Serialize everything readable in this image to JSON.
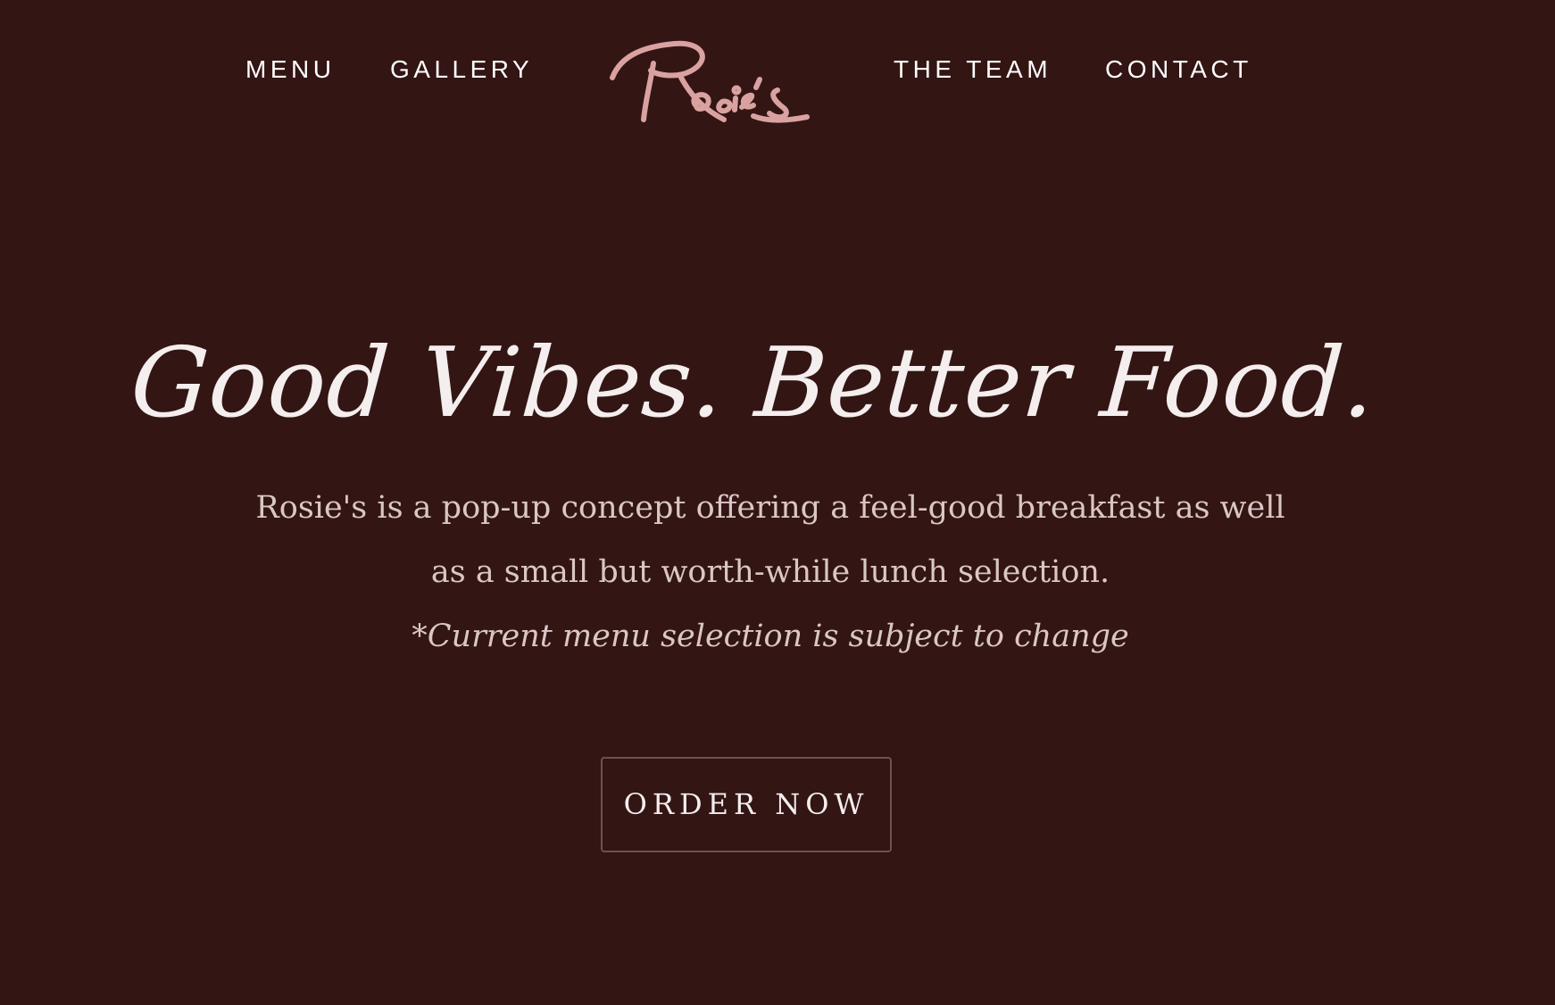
{
  "nav": {
    "left": [
      {
        "label": "MENU"
      },
      {
        "label": "GALLERY"
      }
    ],
    "right": [
      {
        "label": "THE TEAM"
      },
      {
        "label": "CONTACT"
      }
    ]
  },
  "logo": {
    "text": "Rosie's",
    "color": "#d9a2a0"
  },
  "hero": {
    "headline": "Good Vibes. Better Food.",
    "description": "Rosie's is a pop-up concept offering a feel-good breakfast as well as a small but worth-while lunch selection.",
    "note": "*Current menu selection is subject to change"
  },
  "cta": {
    "label": "ORDER NOW"
  },
  "colors": {
    "background": "#331514",
    "text": "#f4eeee",
    "muted_text": "#d9c7c6",
    "logo_pink": "#d9a2a0",
    "button_border": "#6f5150"
  }
}
